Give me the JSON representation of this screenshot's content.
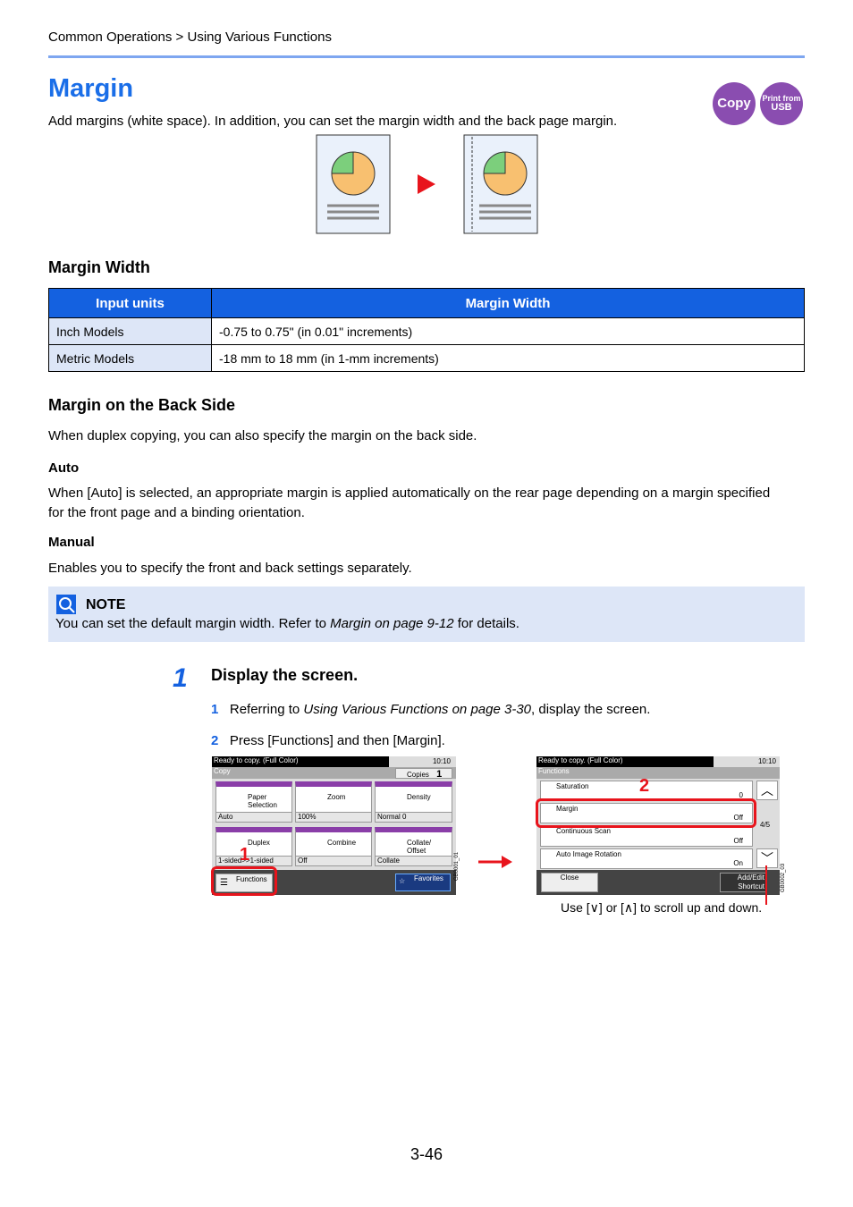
{
  "breadcrumb": "Common Operations > Using Various Functions",
  "title": "Margin",
  "badges": {
    "copy": "Copy",
    "usb_line1": "Print from",
    "usb_line2": "USB"
  },
  "intro": "Add margins (white space). In addition, you can set the margin width and the back page margin.",
  "colors": {
    "accent": "#1a6ee8",
    "badge": "#8a4db0",
    "header": "#1461e0",
    "highlight": "#e8141c"
  },
  "margin_width": {
    "heading": "Margin Width",
    "columns": [
      "Input units",
      "Margin Width"
    ],
    "rows": [
      [
        "Inch Models",
        "-0.75 to 0.75\" (in 0.01\" increments)"
      ],
      [
        "Metric Models",
        "-18 mm to 18 mm (in 1-mm increments)"
      ]
    ]
  },
  "back_side": {
    "heading": "Margin on the Back Side",
    "text": "When duplex copying, you can also specify the margin on the back side.",
    "auto_heading": "Auto",
    "auto_text": "When [Auto] is selected, an appropriate margin is applied automatically on the rear page depending on a margin specified for the front page and a binding orientation.",
    "manual_heading": "Manual",
    "manual_text": "Enables you to specify the front and back settings separately."
  },
  "note": {
    "label": "NOTE",
    "pre": "You can set the default margin width. Refer to ",
    "ref": "Margin on page 9-12",
    "post": " for details."
  },
  "step": {
    "number": "1",
    "title": "Display the screen.",
    "sub1_num": "1",
    "sub1_pre": "Referring to ",
    "sub1_ref": "Using Various Functions on page 3-30",
    "sub1_post": ", display the screen.",
    "sub2_num": "2",
    "sub2": "Press [Functions] and then [Margin]."
  },
  "screen1": {
    "status": "Ready to copy. (Full Color)",
    "time": "10:10",
    "mode": "Copy",
    "copies_label": "Copies",
    "copies": "1",
    "tiles": [
      {
        "label": "Paper Selection",
        "value": "Auto"
      },
      {
        "label": "Zoom",
        "value": "100%"
      },
      {
        "label": "Density",
        "value": "Normal 0"
      },
      {
        "label": "Duplex",
        "value": "1-sided>>1-sided"
      },
      {
        "label": "Combine",
        "value": "Off"
      },
      {
        "label": "Collate/ Offset",
        "value": "Collate"
      }
    ],
    "functions": "Functions",
    "favorites": "Favorites",
    "callout": "1",
    "code": "GB0001_01"
  },
  "screen2": {
    "status": "Ready to copy. (Full Color)",
    "time": "10:10",
    "mode": "Functions",
    "rows": [
      {
        "label": "Saturation",
        "value": "0"
      },
      {
        "label": "Margin",
        "value": "Off"
      },
      {
        "label": "Continuous Scan",
        "value": "Off"
      },
      {
        "label": "Auto Image Rotation",
        "value": "On"
      }
    ],
    "page": "4/5",
    "close": "Close",
    "shortcut": "Add/Edit Shortcut",
    "callout": "2",
    "code": "GB0002_03"
  },
  "scroll_caption": "Use [∨] or [∧] to scroll up and down.",
  "page_number": "3-46"
}
